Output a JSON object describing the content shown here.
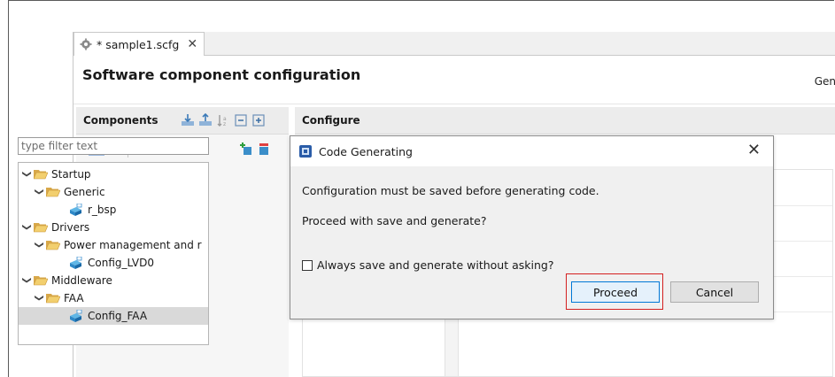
{
  "editor_tab": {
    "label": "* sample1.scfg",
    "close": "✕",
    "icon": "settings-file-icon"
  },
  "page": {
    "title": "Software component configuration",
    "generate_partial": "Gen"
  },
  "components_panel": {
    "title": "Components",
    "filter_placeholder": "type filter text",
    "tree": [
      {
        "label": "Startup",
        "level": 0,
        "type": "folder",
        "expanded": true
      },
      {
        "label": "Generic",
        "level": 1,
        "type": "folder",
        "expanded": true
      },
      {
        "label": "r_bsp",
        "level": 2,
        "type": "component"
      },
      {
        "label": "Drivers",
        "level": 0,
        "type": "folder",
        "expanded": true
      },
      {
        "label": "Power management and r",
        "level": 1,
        "type": "folder",
        "expanded": true
      },
      {
        "label": "Config_LVD0",
        "level": 2,
        "type": "component"
      },
      {
        "label": "Middleware",
        "level": 0,
        "type": "folder",
        "expanded": true
      },
      {
        "label": "FAA",
        "level": 1,
        "type": "folder",
        "expanded": true
      },
      {
        "label": "Config_FAA",
        "level": 2,
        "type": "component",
        "selected": true
      }
    ]
  },
  "configure_panel": {
    "title": "Configure"
  },
  "dialog": {
    "title": "Code Generating",
    "close": "✕",
    "message": "Configuration must be saved before generating code.",
    "question": "Proceed with save and generate?",
    "checkbox_label": "Always save and generate without asking?",
    "checkbox_checked": false,
    "proceed_label": "Proceed",
    "cancel_label": "Cancel",
    "highlight_color": "#d42020"
  }
}
